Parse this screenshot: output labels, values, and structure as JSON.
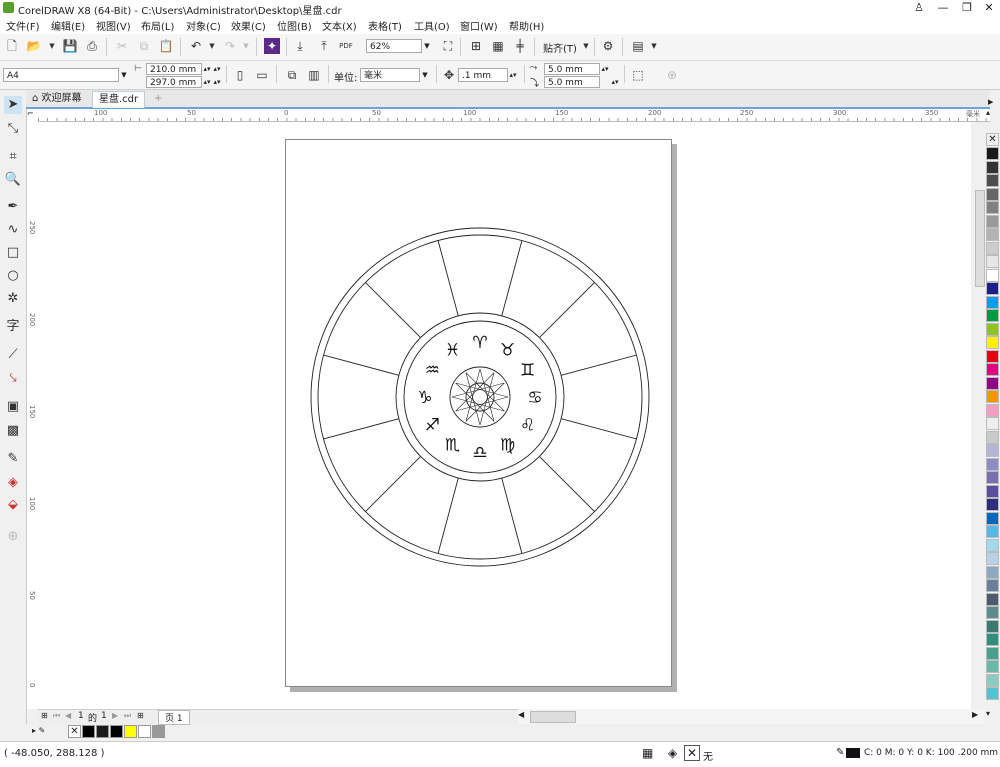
{
  "window": {
    "title": "CorelDRAW X8 (64-Bit) - C:\\Users\\Administrator\\Desktop\\星盘.cdr"
  },
  "menu": [
    "文件(F)",
    "编辑(E)",
    "视图(V)",
    "布局(L)",
    "对象(C)",
    "效果(C)",
    "位图(B)",
    "文本(X)",
    "表格(T)",
    "工具(O)",
    "窗口(W)",
    "帮助(H)"
  ],
  "toolbar": {
    "zoom": "62%",
    "snap_label": "贴齐(T)",
    "pdf_label": "PDF"
  },
  "property_bar": {
    "page_size": "A4",
    "width": "210.0 mm",
    "height": "297.0 mm",
    "units_label": "单位:",
    "units_value": "毫米",
    "nudge": ".1 mm",
    "dup_x": "5.0 mm",
    "dup_y": "5.0 mm"
  },
  "tabs": [
    {
      "label": "欢迎屏幕"
    },
    {
      "label": "星盘.cdr"
    }
  ],
  "ruler": {
    "h_ticks": [
      "100",
      "50",
      "0",
      "50",
      "100",
      "150",
      "200",
      "250",
      "300",
      "350"
    ],
    "unit": "毫米",
    "v_ticks": [
      "250",
      "200",
      "150",
      "100",
      "50",
      "0"
    ]
  },
  "zodiac": {
    "signs": [
      "♈",
      "♉",
      "♊",
      "♋",
      "♌",
      "♍",
      "♎",
      "♏",
      "♐",
      "♑",
      "♒",
      "♓"
    ]
  },
  "page_nav": {
    "current": "1",
    "of_label": "的",
    "total": "1",
    "page_tab": "页 1"
  },
  "status": {
    "coords": "( -48.050, 288.128 )",
    "fill_none": "无",
    "outline_info": "C: 0 M: 0 Y: 0 K: 100  .200 mm"
  },
  "palette_colors": [
    "#1a1a1a",
    "#333333",
    "#4d4d4d",
    "#666666",
    "#808080",
    "#999999",
    "#b3b3b3",
    "#cccccc",
    "#e6e6e6",
    "#ffffff",
    "#1d2088",
    "#00a0e9",
    "#009944",
    "#8fc31f",
    "#fff100",
    "#e60012",
    "#e4007f",
    "#920783",
    "#f39800",
    "#f19ec2",
    "#eeeeee",
    "#c9caca",
    "#b4b4d8",
    "#8c8cc7",
    "#7a6fb1",
    "#5a4f9c",
    "#2e2e7e",
    "#0068b7",
    "#58b7e6",
    "#a3d6ef",
    "#b9d1e6",
    "#8ea8c3",
    "#6a7f99",
    "#4c5b6e",
    "#5c8c8c",
    "#3b7a73",
    "#2f8f7f",
    "#47a08e",
    "#6cb8a8",
    "#8ccbc0",
    "#56c1cf"
  ],
  "doc_palette": [
    "#000000",
    "#1a1a1a",
    "#000000",
    "#ffff00",
    "#ffffff",
    "#999999"
  ]
}
